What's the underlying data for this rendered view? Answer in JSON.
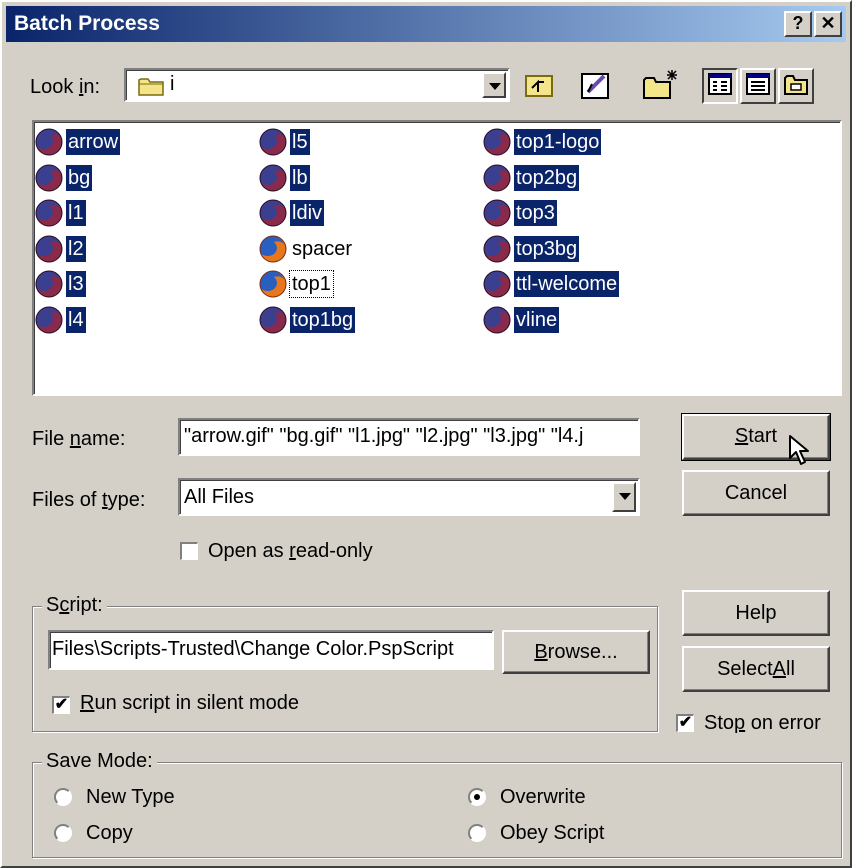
{
  "window": {
    "title": "Batch Process",
    "help_glyph": "?",
    "close_glyph": "✕"
  },
  "look_in": {
    "prefix": "Look ",
    "accel": "i",
    "suffix": "n:",
    "folder": "i"
  },
  "files": {
    "col1": [
      {
        "name": "arrow",
        "selected": true
      },
      {
        "name": "bg",
        "selected": true
      },
      {
        "name": "l1",
        "selected": true
      },
      {
        "name": "l2",
        "selected": true
      },
      {
        "name": "l3",
        "selected": true
      },
      {
        "name": "l4",
        "selected": true
      }
    ],
    "col2": [
      {
        "name": "l5",
        "selected": true
      },
      {
        "name": "lb",
        "selected": true
      },
      {
        "name": "ldiv",
        "selected": true
      },
      {
        "name": "spacer",
        "selected": false
      },
      {
        "name": "top1",
        "selected": false,
        "focused": true
      },
      {
        "name": "top1bg",
        "selected": true
      }
    ],
    "col3": [
      {
        "name": "top1-logo",
        "selected": true
      },
      {
        "name": "top2bg",
        "selected": true
      },
      {
        "name": "top3",
        "selected": true
      },
      {
        "name": "top3bg",
        "selected": true
      },
      {
        "name": "ttl-welcome",
        "selected": true
      },
      {
        "name": "vline",
        "selected": true
      }
    ]
  },
  "file_name": {
    "prefix": "File ",
    "accel": "n",
    "suffix": "ame:",
    "value": "\"arrow.gif\" \"bg.gif\" \"l1.jpg\" \"l2.jpg\" \"l3.jpg\" \"l4.j"
  },
  "file_type": {
    "prefix": "Files of ",
    "accel": "t",
    "suffix": "ype:",
    "value": "All Files"
  },
  "readonly": {
    "prefix": "Open as ",
    "accel": "r",
    "suffix": "ead-only",
    "checked": false
  },
  "buttons": {
    "start": {
      "prefix": "",
      "accel": "S",
      "suffix": "tart"
    },
    "cancel": "Cancel",
    "help": "Help",
    "select_all": {
      "prefix": "Select ",
      "accel": "A",
      "suffix": "ll"
    },
    "browse": {
      "prefix": "",
      "accel": "B",
      "suffix": "rowse..."
    }
  },
  "script": {
    "legend_prefix": "S",
    "legend_accel": "c",
    "legend_suffix": "ript:",
    "path": "Files\\Scripts-Trusted\\Change Color.PspScript",
    "silent": {
      "prefix": "",
      "accel": "R",
      "suffix": "un script in silent mode",
      "checked": true
    }
  },
  "stop_on_error": {
    "prefix": "Sto",
    "accel": "p",
    "suffix": " on error",
    "checked": true
  },
  "save_mode": {
    "legend": "Save Mode:",
    "options": {
      "new_type": "New Type",
      "copy": "Copy",
      "overwrite": "Overwrite",
      "obey_script": "Obey Script"
    },
    "selected": "Overwrite"
  },
  "check_glyph": "✔"
}
